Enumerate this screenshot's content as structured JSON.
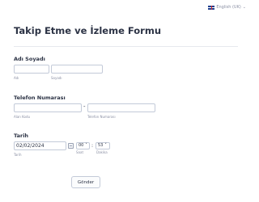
{
  "header": {
    "language": "English (UK)",
    "language_flag": "uk-flag-icon"
  },
  "form": {
    "title": "Takip Etme ve İzleme Formu",
    "name": {
      "label": "Adı Soyadı",
      "first_value": "",
      "last_value": "",
      "first_sub": "Adı",
      "last_sub": "Soyadı"
    },
    "phone": {
      "label": "Telefon Numarası",
      "area_value": "",
      "number_value": "",
      "separator": "-",
      "area_sub": "Alan Kodu",
      "number_sub": "Telefon Numarası"
    },
    "date": {
      "label": "Tarih",
      "date_value": "02/02/2024",
      "date_sub": "Tarih",
      "hour_value": "00",
      "minute_value": "53",
      "time_separator": ":",
      "hour_sub": "Saat",
      "minute_sub": "Dakika"
    },
    "submit_label": "Gönder"
  }
}
